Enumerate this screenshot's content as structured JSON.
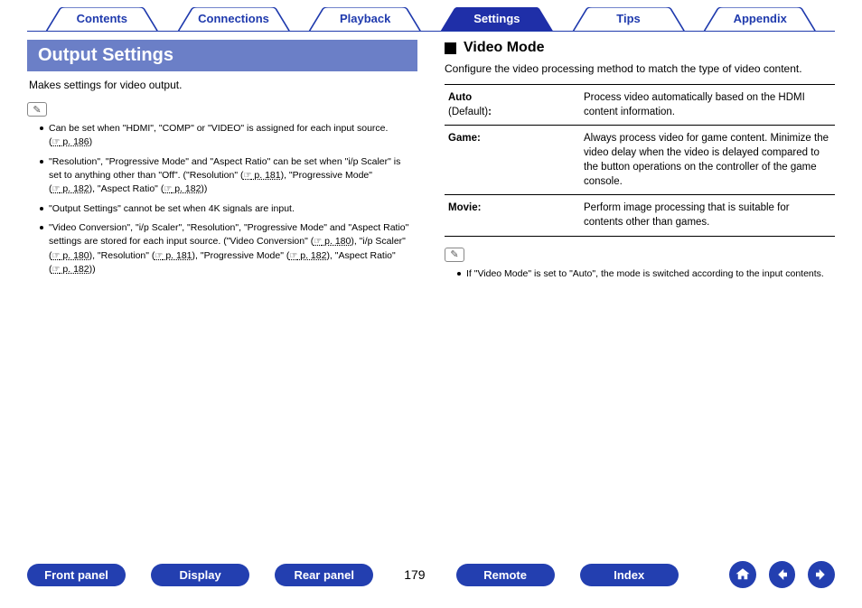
{
  "tabs": {
    "items": [
      "Contents",
      "Connections",
      "Playback",
      "Settings",
      "Tips",
      "Appendix"
    ],
    "activeIndex": 3
  },
  "left": {
    "title": "Output Settings",
    "intro": "Makes settings for video output.",
    "notes": [
      {
        "pre": "Can be set when \"HDMI\", \"COMP\" or \"VIDEO\" is assigned for each input source. (",
        "refs": [
          {
            "t": "p. 186"
          }
        ],
        "post": ")"
      },
      {
        "pre": "\"Resolution\", \"Progressive Mode\" and \"Aspect Ratio\" can be set when \"i/p Scaler\" is set to anything other than \"Off\". (\"Resolution\" (",
        "refs": [
          {
            "t": "p. 181"
          }
        ],
        "mid1": "), \"Progressive Mode\" (",
        "refs2": [
          {
            "t": "p. 182"
          }
        ],
        "mid2": "), \"Aspect Ratio\" (",
        "refs3": [
          {
            "t": "p. 182"
          }
        ],
        "post": "))"
      },
      {
        "pre": "\"Output Settings\" cannot be set when 4K signals are input.",
        "refs": [],
        "post": ""
      },
      {
        "pre": "\"Video Conversion\", \"i/p Scaler\", \"Resolution\", \"Progressive Mode\" and \"Aspect Ratio\" settings are stored for each input source. (\"Video Conversion\" (",
        "refs": [
          {
            "t": "p. 180"
          }
        ],
        "mid1": "), \"i/p Scaler\" (",
        "refs2": [
          {
            "t": "p. 180"
          }
        ],
        "mid2": "), \"Resolution\" (",
        "refs3": [
          {
            "t": "p. 181"
          }
        ],
        "mid3": "), \"Progressive Mode\" (",
        "refs4": [
          {
            "t": "p. 182"
          }
        ],
        "mid4": "), \"Aspect Ratio\" (",
        "refs5": [
          {
            "t": "p. 182"
          }
        ],
        "post": "))"
      }
    ]
  },
  "right": {
    "heading": "Video Mode",
    "desc": "Configure the video processing method to match the type of video content.",
    "rows": [
      {
        "name": "Auto",
        "sub": "(Default)",
        "colon": ":",
        "val": "Process video automatically based on the HDMI content information."
      },
      {
        "name": "Game:",
        "sub": "",
        "colon": "",
        "val": "Always process video for game content. Minimize the video delay when the video is delayed compared to the button operations on the controller of the game console."
      },
      {
        "name": "Movie:",
        "sub": "",
        "colon": "",
        "val": "Perform image processing that is suitable for contents other than games."
      }
    ],
    "note": "If \"Video Mode\" is set to \"Auto\", the mode is switched according to the input contents."
  },
  "footer": {
    "buttons": [
      "Front panel",
      "Display",
      "Rear panel"
    ],
    "page": "179",
    "buttons2": [
      "Remote",
      "Index"
    ],
    "icons": [
      "home-icon",
      "prev-icon",
      "next-icon"
    ]
  }
}
